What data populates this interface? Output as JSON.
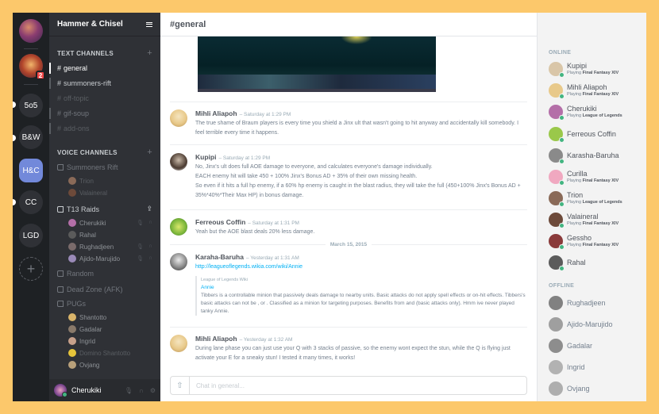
{
  "server": {
    "name": "Hammer & Chisel"
  },
  "guilds": [
    {
      "label": "",
      "badge": ""
    },
    {
      "label": "",
      "badge": "2"
    },
    {
      "label": "5o5",
      "badge": ""
    },
    {
      "label": "B&W",
      "badge": ""
    },
    {
      "label": "H&C",
      "badge": ""
    },
    {
      "label": "CC",
      "badge": ""
    },
    {
      "label": "LGD",
      "badge": ""
    },
    {
      "label": "+",
      "badge": ""
    }
  ],
  "text_channels": {
    "heading": "TEXT CHANNELS",
    "items": [
      "general",
      "summoners-rift",
      "off-topic",
      "gif-soup",
      "add-ons"
    ]
  },
  "voice_channels": {
    "heading": "VOICE CHANNELS",
    "summoners_rift": {
      "name": "Summoners Rift",
      "users": [
        "Trion",
        "Valaineral"
      ]
    },
    "t13_raids": {
      "name": "T13 Raids",
      "users": [
        "Cherukiki",
        "Rahal",
        "Rughadjeen",
        "Ajido-Marujido"
      ]
    },
    "random": {
      "name": "Random"
    },
    "dead_zone": {
      "name": "Dead Zone (AFK)"
    },
    "pugs": {
      "name": "PUGs",
      "users": [
        "Shantotto",
        "Gadalar",
        "Ingrid",
        "Domino Shantotto",
        "Ovjang"
      ]
    }
  },
  "current_user": {
    "name": "Cherukiki"
  },
  "channel": {
    "title": "#general"
  },
  "messages": [
    {
      "author": "Mihli Aliapoh",
      "time": "Saturday at 1:29 PM",
      "lines": [
        "The true shame of Braum players is every time you shield a Jinx ult that wasn't going to hit anyway and accidentally kill somebody. I feel terrible every time it happens."
      ]
    },
    {
      "author": "Kupipi",
      "time": "Saturday at 1:29 PM",
      "lines": [
        "No, Jinx's ult does full AOE damage to everyone, and calculates everyone's damage individually.",
        "EACH enemy hit will take 450 + 100% Jinx's Bonus AD + 35% of their own missing health.",
        "So even if it hits a full hp enemy, if a 60% hp enemy is caught in the blast radius, they will take the full (450+100% Jinx's Bonus AD + 35%*40%*Their Max HP) in bonus damage."
      ]
    },
    {
      "author": "Ferreous Coffin",
      "time": "Saturday at 1:31 PM",
      "lines": [
        "Yeah but the AOE blast deals 20% less damage."
      ]
    },
    {
      "author": "Karaha-Baruha",
      "time": "Yesterday at 1:31 AM",
      "link": "http://leagueoflegends.wikia.com/wiki/Annie",
      "embed": {
        "provider": "League of Legends Wiki",
        "title": "Annie",
        "text": "Tibbers is a controllable minion that passively deals damage to nearby units. Basic attacks do not apply spell effects or on-hit effects. Tibbers's basic attacks can not be , or . Classified as a minion for targeting purposes. Benefits from and (basic attacks only). Hmm ive never played tanky Annie."
      }
    },
    {
      "author": "Mihli Aliapoh",
      "time": "Yesterday at 1:32 AM",
      "lines": [
        "During lane phase you can just use your Q with 3 stacks of passive, so the enemy wont expect the stun, while the Q is flying just activate your E for a sneaky stun! I tested it many times, it works!"
      ]
    }
  ],
  "date_separator": "March 15, 2015",
  "composer": {
    "placeholder": "Chat in general..."
  },
  "members": {
    "online_heading": "ONLINE",
    "offline_heading": "OFFLINE",
    "playing_prefix": "Playing",
    "online": [
      {
        "name": "Kupipi",
        "game": "Final Fantasy XIV"
      },
      {
        "name": "Mihli Aliapoh",
        "game": "Final Fantasy XIV"
      },
      {
        "name": "Cherukiki",
        "game": "League of Legends"
      },
      {
        "name": "Ferreous Coffin",
        "game": ""
      },
      {
        "name": "Karasha-Baruha",
        "game": ""
      },
      {
        "name": "Curilla",
        "game": "Final Fantasy XIV"
      },
      {
        "name": "Trion",
        "game": "League of Legends"
      },
      {
        "name": "Valaineral",
        "game": "Final Fantasy XIV"
      },
      {
        "name": "Gessho",
        "game": "Final Fantasy XIV"
      },
      {
        "name": "Rahal",
        "game": ""
      }
    ],
    "offline": [
      {
        "name": "Rughadjeen"
      },
      {
        "name": "Ajido-Marujido"
      },
      {
        "name": "Gadalar"
      },
      {
        "name": "Ingrid"
      },
      {
        "name": "Ovjang"
      }
    ]
  },
  "colors": {
    "accent": "#7289da",
    "online": "#43b581",
    "badge": "#f04747",
    "link": "#00b0f4"
  }
}
